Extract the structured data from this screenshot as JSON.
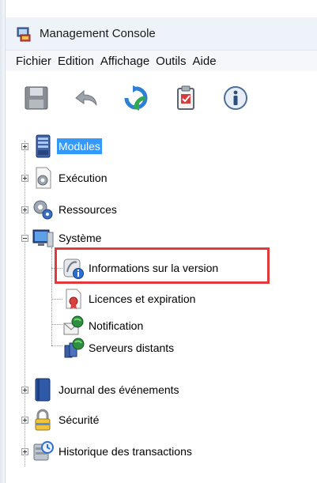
{
  "window": {
    "title": "Management Console",
    "app_icon": "management-console-icon"
  },
  "menu": {
    "items": [
      "Fichier",
      "Edition",
      "Affichage",
      "Outils",
      "Aide"
    ]
  },
  "toolbar": {
    "buttons": [
      {
        "name": "save-button",
        "icon": "floppy-disk-icon"
      },
      {
        "name": "undo-button",
        "icon": "undo-arrow-icon"
      },
      {
        "name": "refresh-button",
        "icon": "refresh-icon"
      },
      {
        "name": "clipboard-button",
        "icon": "clipboard-icon"
      },
      {
        "name": "info-button",
        "icon": "info-icon"
      }
    ]
  },
  "tree": {
    "nodes": [
      {
        "label": "Modules",
        "icon": "server-icon",
        "selected": true
      },
      {
        "label": "Exécution",
        "icon": "gear-document-icon"
      },
      {
        "label": "Ressources",
        "icon": "gears-icon"
      },
      {
        "label": "Système",
        "icon": "monitor-icon"
      },
      {
        "label": "Informations sur la version",
        "icon": "version-info-icon"
      },
      {
        "label": "Licences et expiration",
        "icon": "license-icon"
      },
      {
        "label": "Notification",
        "icon": "notification-envelope-icon"
      },
      {
        "label": "Serveurs distants",
        "icon": "remote-servers-icon"
      },
      {
        "label": "Journal des événements",
        "icon": "book-icon"
      },
      {
        "label": "Sécurité",
        "icon": "lock-icon"
      },
      {
        "label": "Historique des transactions",
        "icon": "history-icon"
      }
    ]
  },
  "colors": {
    "selection": "#3399ff",
    "highlight_border": "#e03a3a"
  }
}
